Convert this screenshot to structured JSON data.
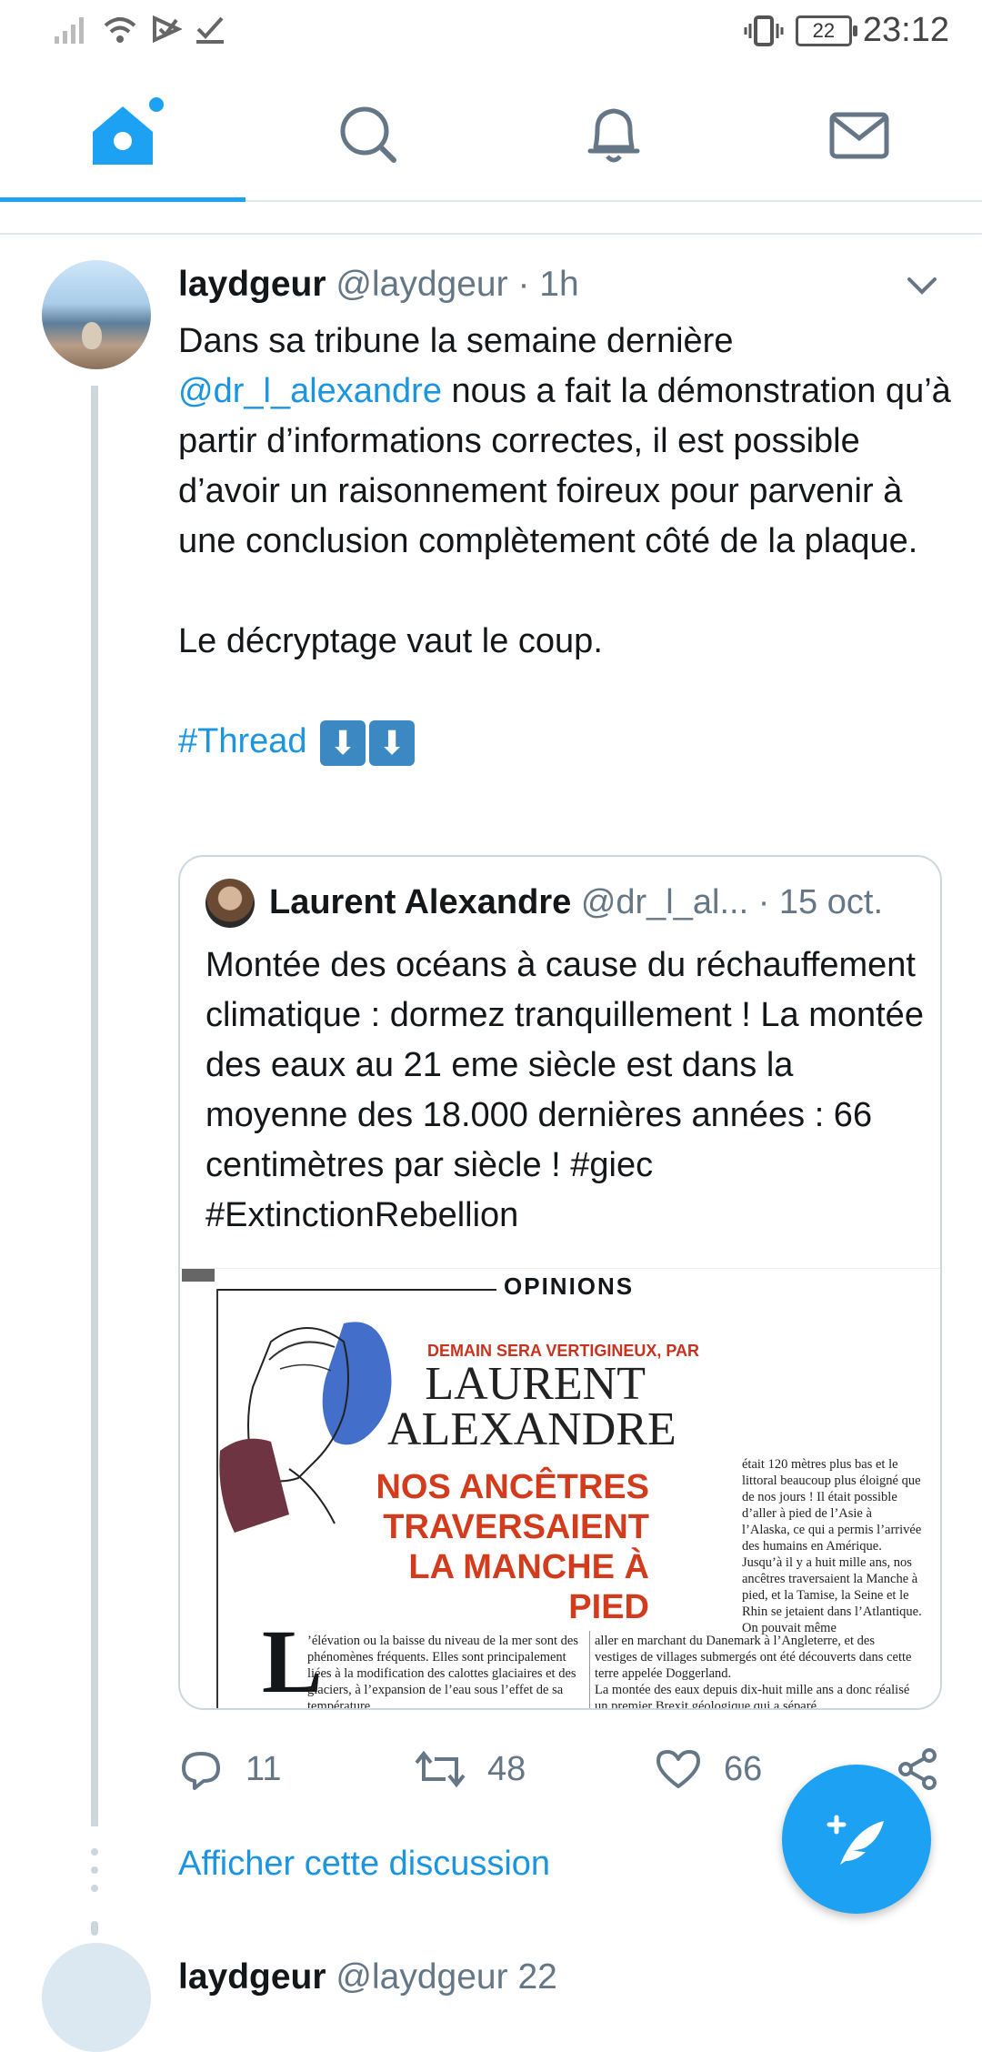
{
  "status_bar": {
    "time": "23:12",
    "battery": "22"
  },
  "nav": {
    "tabs": [
      "Accueil",
      "Rechercher",
      "Notifications",
      "Messages"
    ],
    "active": "Accueil"
  },
  "tweet": {
    "name": "laydgeur",
    "handle": "@laydgeur",
    "separator": "·",
    "time": "1h",
    "text_line1_pre": "Dans sa tribune la semaine dernière",
    "mention": "@dr_l_alexandre",
    "text_line1_post": " nous a fait la démonstration qu’à partir d’informations correctes, il est possible d’avoir un raisonnement foireux pour parvenir à une conclusion complètement côté de la plaque.",
    "text_para2": "Le décryptage vaut le coup.",
    "hashtag": "#Thread",
    "emoji": "⬇",
    "quote": {
      "name": "Laurent Alexandre",
      "handle": "@dr_l_al...",
      "separator": "·",
      "date": "15 oct.",
      "text": "Montée des océans à cause du réchauffement climatique : dormez tranquillement ! La montée des eaux au 21 eme siècle est dans la moyenne des 18.000 dernières années : 66 centimètres par siècle ! #giec #ExtinctionRebellion",
      "image": {
        "section": "OPINIONS",
        "kicker": "DEMAIN SERA VERTIGINEUX, PAR",
        "author": "LAURENT ALEXANDRE",
        "headline": "NOS ANCÊTRES TRAVERSAIENT LA MANCHE À PIED",
        "dropcap": "L",
        "col1": "’élévation ou la baisse du niveau de la mer sont des phénomènes fréquents. Elles sont principalement liées à la modification des calottes glaciaires et des glaciers, à l’expansion de l’eau sous l’effet de sa température",
        "col2": "aller en marchant du Danemark à l’Angleterre, et des vestiges de villages submergés ont été découverts dans cette terre appelée Doggerland.\nLa montée des eaux depuis dix-huit mille ans a donc réalisé un premier Brexit géologique qui a séparé",
        "col3": "était 120 mètres plus bas et le littoral beaucoup plus éloigné que de nos jours ! Il était possible d’aller à pied de l’Asie à l’Alaska, ce qui a permis l’arrivée des humains en Amérique. Jusqu’à il y a huit mille ans, nos ancêtres traversaient la Manche à pied, et la Tamise, la Seine et le Rhin se jetaient dans l’Atlantique. On pouvait même"
      }
    },
    "replies": "11",
    "retweets": "48",
    "likes": "66"
  },
  "show_thread": "Afficher cette discussion",
  "next_tweet": {
    "name": "laydgeur",
    "handle": "@laydgeur",
    "time": "22"
  },
  "colors": {
    "accent": "#1da1f2",
    "link": "#1b95e0",
    "muted": "#657786",
    "border": "#ccd6dd"
  }
}
